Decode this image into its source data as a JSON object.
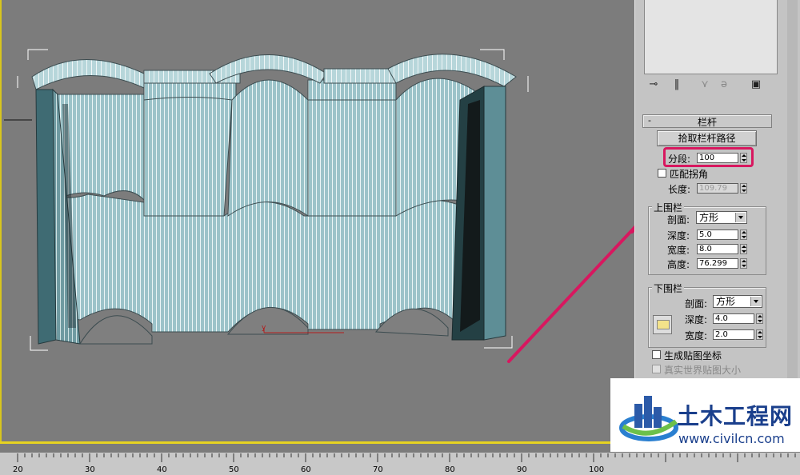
{
  "ruler": {
    "ticks": [
      "20",
      "30",
      "40",
      "50",
      "60",
      "70",
      "80",
      "90",
      "100"
    ]
  },
  "viewport": {
    "axis_label": "y"
  },
  "toolbar": {
    "icons": [
      "pin-icon",
      "stack-icon",
      "separator",
      "fork-icon",
      "lock-icon",
      "separator",
      "configure-icon"
    ]
  },
  "railing": {
    "rollout_toggle": "-",
    "rollout_title": "栏杆",
    "pick_path_button": "拾取栏杆路径",
    "segments_label": "分段:",
    "segments_value": "100",
    "match_corners_label": "匹配拐角",
    "length_label": "长度:",
    "length_value": "109.79",
    "top_rail": {
      "title": "上围栏",
      "profile_label": "剖面:",
      "profile_value": "方形",
      "depth_label": "深度:",
      "depth_value": "5.0",
      "width_label": "宽度:",
      "width_value": "8.0",
      "height_label": "高度:",
      "height_value": "76.299"
    },
    "lower_rail": {
      "title": "下围栏",
      "profile_label": "剖面:",
      "profile_value": "方形",
      "depth_label": "深度:",
      "depth_value": "4.0",
      "width_label": "宽度:",
      "width_value": "2.0"
    },
    "generate_mapping_label": "生成贴图坐标",
    "real_world_map_label": "真实世界贴图大小"
  },
  "watermark": {
    "title": "土木工程网",
    "url": "www.civilcn.com"
  },
  "colors": {
    "highlight": "#d8175f",
    "arrow": "#d8175f",
    "viewport_border": "#e6d321",
    "mesh": "#9cc3c9"
  }
}
